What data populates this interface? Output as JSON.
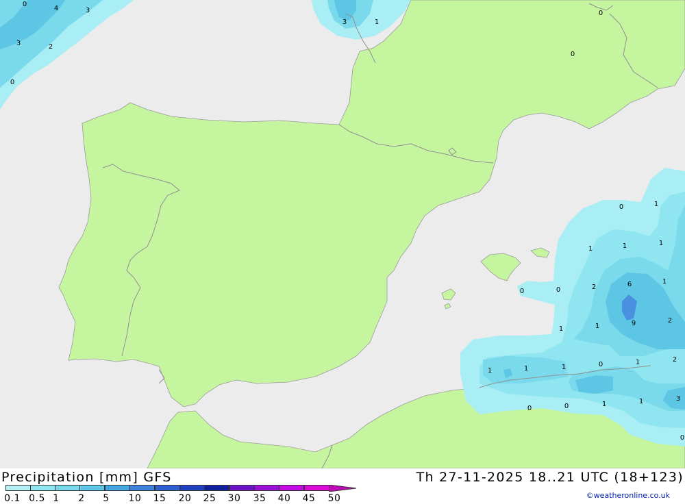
{
  "map": {
    "colors": {
      "sea": "#ececec",
      "land": "#c6f5a0",
      "precip_0_1": "#a8eef4",
      "precip_0_5": "#8fe6f0",
      "precip_1": "#7ad9ea",
      "precip_2": "#5cc6e4",
      "precip_5": "#4a90e0"
    },
    "contour_labels": [
      {
        "id": "nw-0a",
        "value": "0"
      },
      {
        "id": "nw-4",
        "value": "4"
      },
      {
        "id": "nw-3a",
        "value": "3"
      },
      {
        "id": "nw-3b",
        "value": "3"
      },
      {
        "id": "nw-2",
        "value": "2"
      },
      {
        "id": "nw-0b",
        "value": "0"
      },
      {
        "id": "ch-3",
        "value": "3"
      },
      {
        "id": "ch-1",
        "value": "1"
      },
      {
        "id": "fr-0a",
        "value": "0"
      },
      {
        "id": "fr-0b",
        "value": "0"
      },
      {
        "id": "ee-0",
        "value": "0"
      },
      {
        "id": "ee-1a",
        "value": "1"
      },
      {
        "id": "ee-1b",
        "value": "1"
      },
      {
        "id": "ee-1c",
        "value": "1"
      },
      {
        "id": "ee-1d",
        "value": "1"
      },
      {
        "id": "ee-2a",
        "value": "2"
      },
      {
        "id": "ee-6",
        "value": "6"
      },
      {
        "id": "ee-1e",
        "value": "1"
      },
      {
        "id": "bal-0a",
        "value": "0"
      },
      {
        "id": "bal-0b",
        "value": "0"
      },
      {
        "id": "ee-1f",
        "value": "1"
      },
      {
        "id": "ee-1g",
        "value": "1"
      },
      {
        "id": "ee-9",
        "value": "9"
      },
      {
        "id": "ee-2b",
        "value": "2"
      },
      {
        "id": "af-1a",
        "value": "1"
      },
      {
        "id": "af-1b",
        "value": "1"
      },
      {
        "id": "af-1c",
        "value": "1"
      },
      {
        "id": "af-0a",
        "value": "0"
      },
      {
        "id": "af-1d",
        "value": "1"
      },
      {
        "id": "af-2",
        "value": "2"
      },
      {
        "id": "af-0b",
        "value": "0"
      },
      {
        "id": "af-0c",
        "value": "0"
      },
      {
        "id": "af-1e",
        "value": "1"
      },
      {
        "id": "af-1f",
        "value": "1"
      },
      {
        "id": "af-3",
        "value": "3"
      },
      {
        "id": "af-0d",
        "value": "0"
      }
    ]
  },
  "footer": {
    "title_left": "Precipitation [mm] GFS",
    "title_right": "Th 27-11-2025 18..21 UTC (18+123)",
    "credit": "©weatheronline.co.uk",
    "scale": {
      "ticks": [
        "0.1",
        "0.5",
        "1",
        "2",
        "5",
        "10",
        "15",
        "20",
        "25",
        "30",
        "35",
        "40",
        "45",
        "50"
      ],
      "colors": [
        "#b4f0f4",
        "#8fe6f0",
        "#7ad9ea",
        "#5cc6e4",
        "#46a8e2",
        "#3f82dc",
        "#2f5fd0",
        "#1f3fbe",
        "#12209e",
        "#6a12c8",
        "#9a10d8",
        "#c40ae4",
        "#de08d8",
        "#c008b6"
      ]
    }
  }
}
